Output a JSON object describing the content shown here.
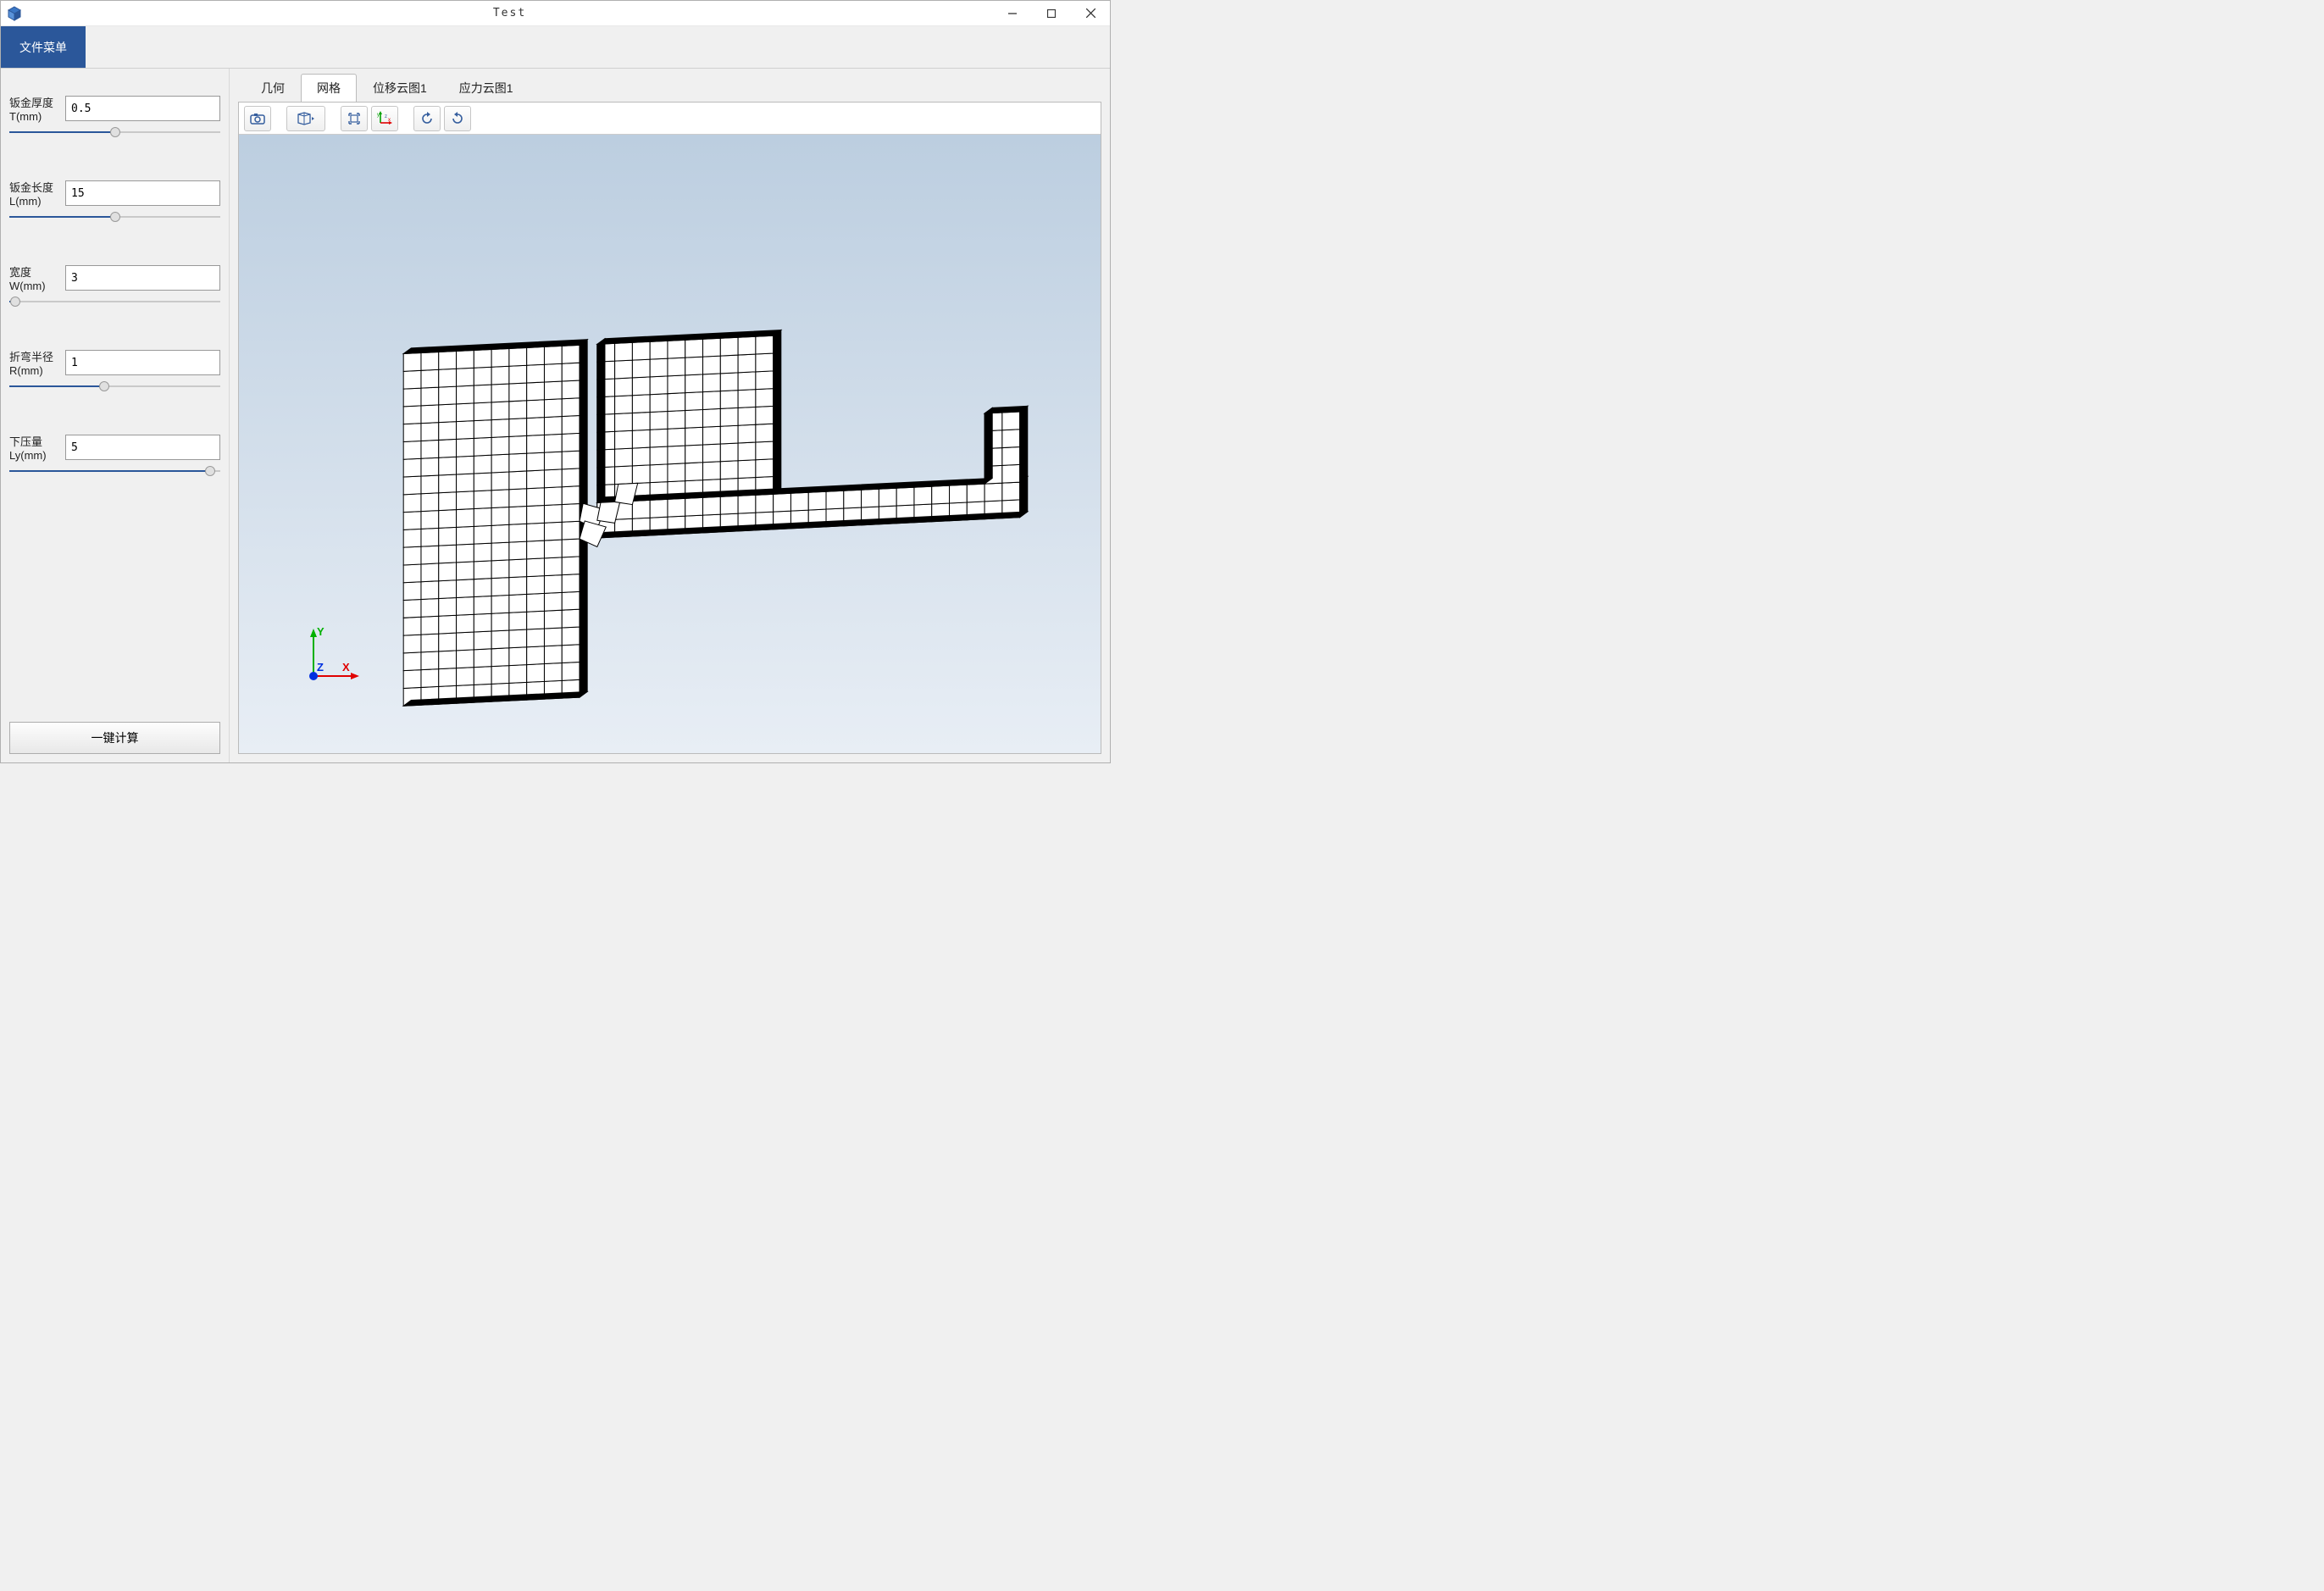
{
  "window": {
    "title": "Test"
  },
  "menu": {
    "file": "文件菜单"
  },
  "params": {
    "thickness": {
      "label": "钣金厚度T(mm)",
      "value": "0.5",
      "slider_pct": 50
    },
    "length": {
      "label": "钣金长度L(mm)",
      "value": "15",
      "slider_pct": 50
    },
    "width": {
      "label": "宽度W(mm)",
      "value": "3",
      "slider_pct": 3
    },
    "radius": {
      "label": "折弯半径R(mm)",
      "value": "1",
      "slider_pct": 45
    },
    "press": {
      "label": "下压量Ly(mm)",
      "value": "5",
      "slider_pct": 95
    }
  },
  "calc_button": "一键计算",
  "tabs": {
    "geometry": "几何",
    "mesh": "网格",
    "disp": "位移云图1",
    "stress": "应力云图1",
    "active": "mesh"
  },
  "toolbar_icons": {
    "camera": "camera-icon",
    "cube": "cube-icon",
    "extent": "fit-extent-icon",
    "axes": "axes-icon",
    "rotate_ccw": "rotate-ccw-icon",
    "rotate_cw": "rotate-cw-icon"
  },
  "triad": {
    "x": "X",
    "y": "Y",
    "z": "Z"
  }
}
